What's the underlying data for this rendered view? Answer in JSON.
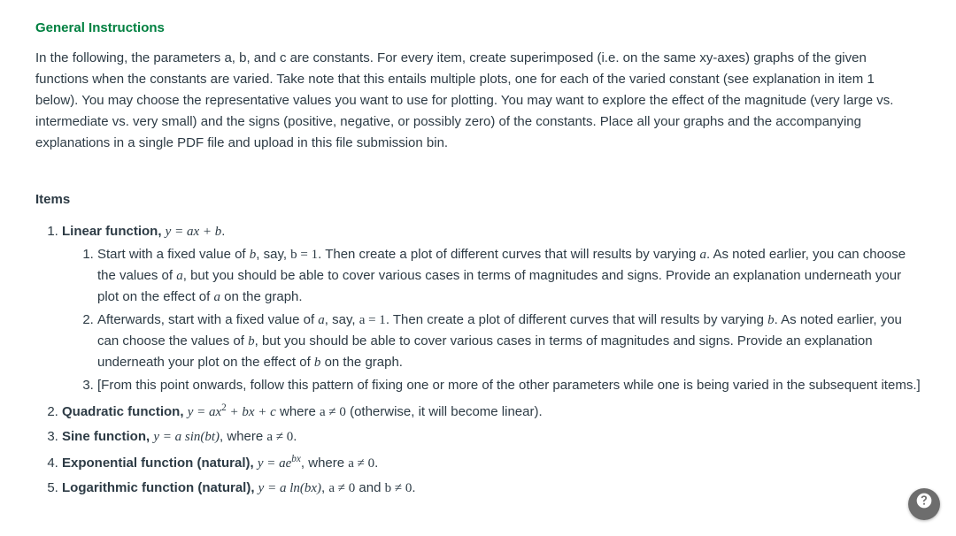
{
  "headings": {
    "general": "General Instructions",
    "items": "Items"
  },
  "intro": "In the following, the parameters a, b, and c are constants. For every item, create superimposed (i.e. on the same xy-axes) graphs of the given functions when the constants are varied. Take note that this entails multiple plots, one for each of the varied constant (see explanation in item 1 below). You may choose the representative values you want to use for plotting. You may want to explore the effect of the magnitude (very large vs. intermediate vs. very small) and the signs (positive, negative, or possibly zero) of the constants. Place all your graphs and the accompanying explanations in a single PDF file and upload in this file submission bin.",
  "item1": {
    "title_bold": "Linear function, ",
    "title_post": ".",
    "sub1_a": "Start with a fixed value of ",
    "sub1_b": ", say, ",
    "sub1_c": ". Then create a plot of different curves that will results by varying ",
    "sub1_d": ". As noted earlier, you can choose the values of ",
    "sub1_e": ", but you should be able to cover various cases in terms of magnitudes and signs. Provide an explanation underneath your plot on the effect of ",
    "sub1_f": " on the graph.",
    "sub2_a": "Afterwards, start with a fixed value of ",
    "sub2_b": ", say, ",
    "sub2_c": ". Then create a plot of different curves that will results by varying ",
    "sub2_d": ". As noted earlier, you can choose the values of ",
    "sub2_e": ", but you should be able to cover various cases in terms of magnitudes and signs. Provide an explanation underneath your plot on the effect of ",
    "sub2_f": " on the graph.",
    "sub3": "[From this point onwards, follow this pattern of fixing one or more of the other parameters while one is being varied in the subsequent items.]"
  },
  "item2": {
    "bold": "Quadratic function, ",
    "mid": " where ",
    "tail": " (otherwise, it will become linear)."
  },
  "item3": {
    "bold": "Sine function, ",
    "mid": ", where ",
    "tail": "."
  },
  "item4": {
    "bold": "Exponential function (natural), ",
    "mid": ", where ",
    "tail": "."
  },
  "item5": {
    "bold": "Logarithmic function (natural), ",
    "mid": " and ",
    "tail": "."
  },
  "math": {
    "a": "a",
    "b": "b",
    "c": "c",
    "y_eq_ax_b": "y = ax + b",
    "b_eq_1": "b = 1",
    "a_eq_1": "a = 1",
    "y_eq_ax2_bx_c_pre": "y = ax",
    "y_eq_ax2_bx_c_post": " + bx + c",
    "a_ne_0": "a ≠ 0",
    "y_eq_a_sin_bt": "y = a sin(bt)",
    "y_eq_ae_pre": "y = ae",
    "y_eq_ae_sup": "bx",
    "y_eq_a_ln_bx": "y = a ln(bx)",
    "b_ne_0": "b ≠ 0",
    "sep_comma": ", "
  }
}
